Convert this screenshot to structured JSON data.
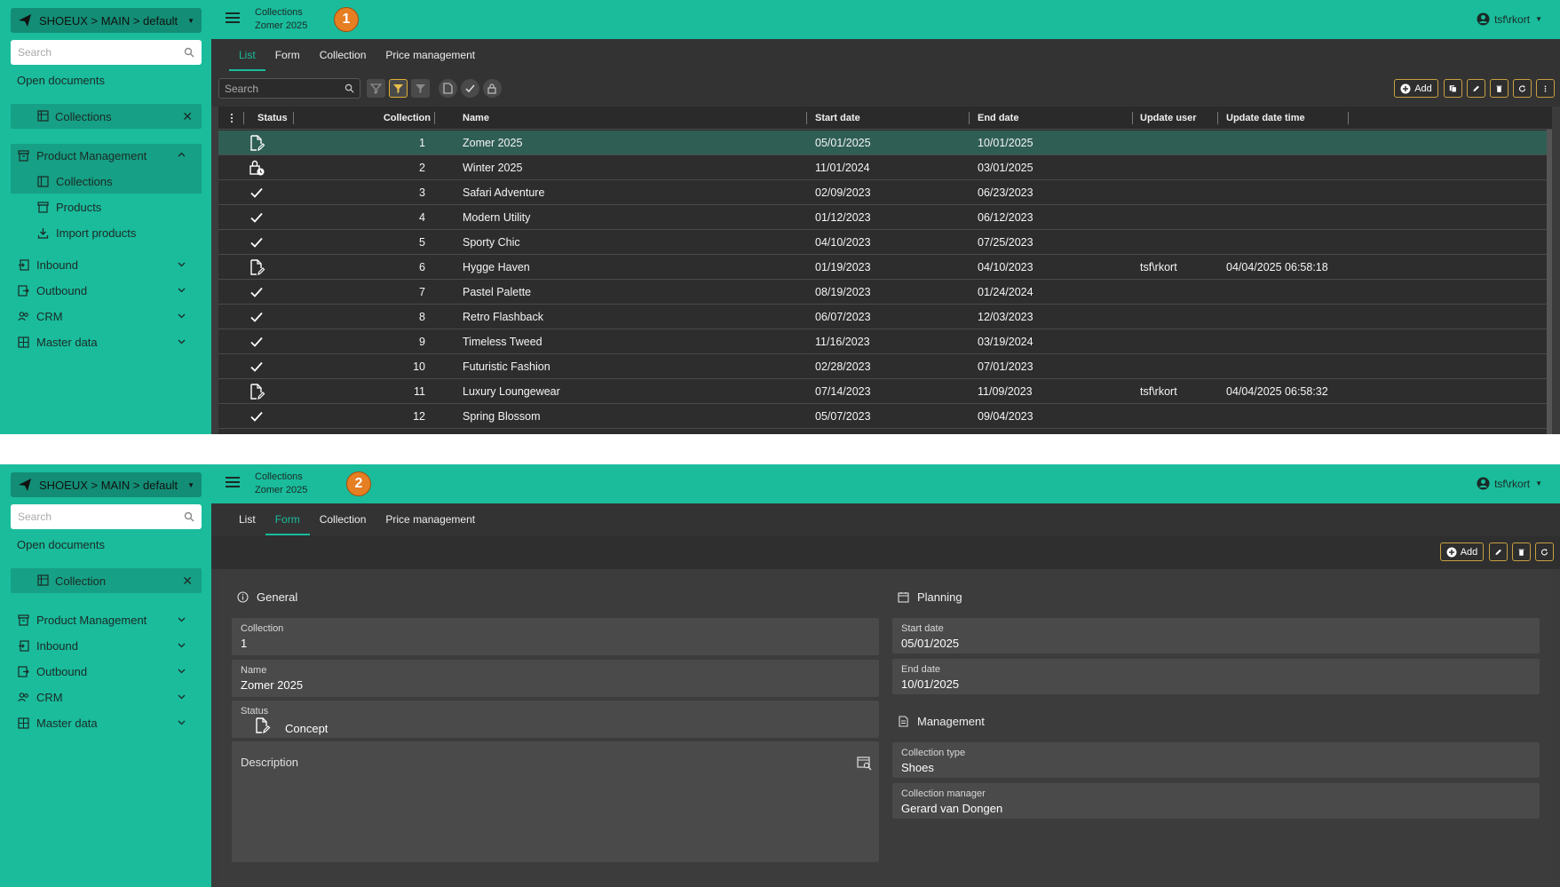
{
  "env": "SHOEUX > MAIN > default",
  "sidebar": {
    "search_placeholder": "Search",
    "open_documents": "Open documents",
    "product_management": "Product Management",
    "collections": "Collections",
    "products": "Products",
    "import_products": "Import products",
    "inbound": "Inbound",
    "outbound": "Outbound",
    "crm": "CRM",
    "master_data": "Master data"
  },
  "panel1": {
    "doc_tab": "Collections",
    "step": "1"
  },
  "panel2": {
    "doc_tab": "Collection",
    "step": "2"
  },
  "header": {
    "title": "Collections",
    "subtitle": "Zomer 2025",
    "user": "tsf\\rkort"
  },
  "tabs": [
    "List",
    "Form",
    "Collection",
    "Price management"
  ],
  "toolbar": {
    "search_placeholder": "Search",
    "add_label": "Add"
  },
  "table": {
    "columns": [
      "Status",
      "Collection",
      "Name",
      "Start date",
      "End date",
      "Update user",
      "Update date time"
    ],
    "rows": [
      {
        "status": "concept",
        "collection": "1",
        "name": "Zomer 2025",
        "start": "05/01/2025",
        "end": "10/01/2025",
        "user": "",
        "updated": ""
      },
      {
        "status": "locked",
        "collection": "2",
        "name": "Winter 2025",
        "start": "11/01/2024",
        "end": "03/01/2025",
        "user": "",
        "updated": ""
      },
      {
        "status": "done",
        "collection": "3",
        "name": "Safari Adventure",
        "start": "02/09/2023",
        "end": "06/23/2023",
        "user": "",
        "updated": ""
      },
      {
        "status": "done",
        "collection": "4",
        "name": "Modern Utility",
        "start": "01/12/2023",
        "end": "06/12/2023",
        "user": "",
        "updated": ""
      },
      {
        "status": "done",
        "collection": "5",
        "name": "Sporty Chic",
        "start": "04/10/2023",
        "end": "07/25/2023",
        "user": "",
        "updated": ""
      },
      {
        "status": "concept",
        "collection": "6",
        "name": "Hygge Haven",
        "start": "01/19/2023",
        "end": "04/10/2023",
        "user": "tsf\\rkort",
        "updated": "04/04/2025 06:58:18"
      },
      {
        "status": "done",
        "collection": "7",
        "name": "Pastel Palette",
        "start": "08/19/2023",
        "end": "01/24/2024",
        "user": "",
        "updated": ""
      },
      {
        "status": "done",
        "collection": "8",
        "name": "Retro Flashback",
        "start": "06/07/2023",
        "end": "12/03/2023",
        "user": "",
        "updated": ""
      },
      {
        "status": "done",
        "collection": "9",
        "name": "Timeless Tweed",
        "start": "11/16/2023",
        "end": "03/19/2024",
        "user": "",
        "updated": ""
      },
      {
        "status": "done",
        "collection": "10",
        "name": "Futuristic Fashion",
        "start": "02/28/2023",
        "end": "07/01/2023",
        "user": "",
        "updated": ""
      },
      {
        "status": "concept",
        "collection": "11",
        "name": "Luxury Loungewear",
        "start": "07/14/2023",
        "end": "11/09/2023",
        "user": "tsf\\rkort",
        "updated": "04/04/2025 06:58:32"
      },
      {
        "status": "done",
        "collection": "12",
        "name": "Spring Blossom",
        "start": "05/07/2023",
        "end": "09/04/2023",
        "user": "",
        "updated": ""
      }
    ]
  },
  "form": {
    "general_title": "General",
    "planning_title": "Planning",
    "management_title": "Management",
    "collection_label": "Collection",
    "collection_value": "1",
    "name_label": "Name",
    "name_value": "Zomer 2025",
    "status_label": "Status",
    "status_value": "Concept",
    "description_label": "Description",
    "start_label": "Start date",
    "start_value": "05/01/2025",
    "end_label": "End date",
    "end_value": "10/01/2025",
    "type_label": "Collection type",
    "type_value": "Shoes",
    "manager_label": "Collection manager",
    "manager_value": "Gerard van Dongen"
  },
  "colors": {
    "brand": "#1abc9c",
    "step_badge": "#e67e22",
    "selected_row": "#2f5e55"
  }
}
